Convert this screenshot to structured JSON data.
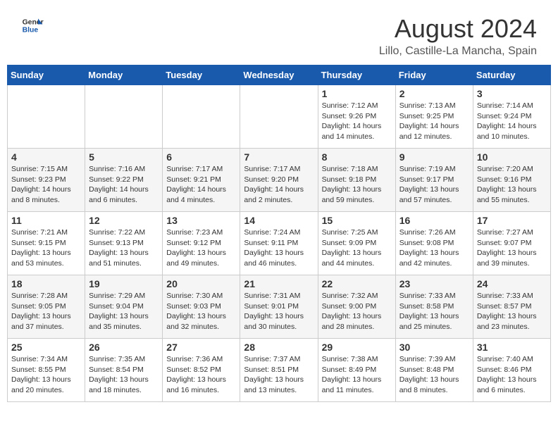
{
  "header": {
    "logo_text_general": "General",
    "logo_text_blue": "Blue",
    "month_title": "August 2024",
    "location": "Lillo, Castille-La Mancha, Spain"
  },
  "days_of_week": [
    "Sunday",
    "Monday",
    "Tuesday",
    "Wednesday",
    "Thursday",
    "Friday",
    "Saturday"
  ],
  "weeks": [
    [
      {
        "day": "",
        "info": ""
      },
      {
        "day": "",
        "info": ""
      },
      {
        "day": "",
        "info": ""
      },
      {
        "day": "",
        "info": ""
      },
      {
        "day": "1",
        "info": "Sunrise: 7:12 AM\nSunset: 9:26 PM\nDaylight: 14 hours\nand 14 minutes."
      },
      {
        "day": "2",
        "info": "Sunrise: 7:13 AM\nSunset: 9:25 PM\nDaylight: 14 hours\nand 12 minutes."
      },
      {
        "day": "3",
        "info": "Sunrise: 7:14 AM\nSunset: 9:24 PM\nDaylight: 14 hours\nand 10 minutes."
      }
    ],
    [
      {
        "day": "4",
        "info": "Sunrise: 7:15 AM\nSunset: 9:23 PM\nDaylight: 14 hours\nand 8 minutes."
      },
      {
        "day": "5",
        "info": "Sunrise: 7:16 AM\nSunset: 9:22 PM\nDaylight: 14 hours\nand 6 minutes."
      },
      {
        "day": "6",
        "info": "Sunrise: 7:17 AM\nSunset: 9:21 PM\nDaylight: 14 hours\nand 4 minutes."
      },
      {
        "day": "7",
        "info": "Sunrise: 7:17 AM\nSunset: 9:20 PM\nDaylight: 14 hours\nand 2 minutes."
      },
      {
        "day": "8",
        "info": "Sunrise: 7:18 AM\nSunset: 9:18 PM\nDaylight: 13 hours\nand 59 minutes."
      },
      {
        "day": "9",
        "info": "Sunrise: 7:19 AM\nSunset: 9:17 PM\nDaylight: 13 hours\nand 57 minutes."
      },
      {
        "day": "10",
        "info": "Sunrise: 7:20 AM\nSunset: 9:16 PM\nDaylight: 13 hours\nand 55 minutes."
      }
    ],
    [
      {
        "day": "11",
        "info": "Sunrise: 7:21 AM\nSunset: 9:15 PM\nDaylight: 13 hours\nand 53 minutes."
      },
      {
        "day": "12",
        "info": "Sunrise: 7:22 AM\nSunset: 9:13 PM\nDaylight: 13 hours\nand 51 minutes."
      },
      {
        "day": "13",
        "info": "Sunrise: 7:23 AM\nSunset: 9:12 PM\nDaylight: 13 hours\nand 49 minutes."
      },
      {
        "day": "14",
        "info": "Sunrise: 7:24 AM\nSunset: 9:11 PM\nDaylight: 13 hours\nand 46 minutes."
      },
      {
        "day": "15",
        "info": "Sunrise: 7:25 AM\nSunset: 9:09 PM\nDaylight: 13 hours\nand 44 minutes."
      },
      {
        "day": "16",
        "info": "Sunrise: 7:26 AM\nSunset: 9:08 PM\nDaylight: 13 hours\nand 42 minutes."
      },
      {
        "day": "17",
        "info": "Sunrise: 7:27 AM\nSunset: 9:07 PM\nDaylight: 13 hours\nand 39 minutes."
      }
    ],
    [
      {
        "day": "18",
        "info": "Sunrise: 7:28 AM\nSunset: 9:05 PM\nDaylight: 13 hours\nand 37 minutes."
      },
      {
        "day": "19",
        "info": "Sunrise: 7:29 AM\nSunset: 9:04 PM\nDaylight: 13 hours\nand 35 minutes."
      },
      {
        "day": "20",
        "info": "Sunrise: 7:30 AM\nSunset: 9:03 PM\nDaylight: 13 hours\nand 32 minutes."
      },
      {
        "day": "21",
        "info": "Sunrise: 7:31 AM\nSunset: 9:01 PM\nDaylight: 13 hours\nand 30 minutes."
      },
      {
        "day": "22",
        "info": "Sunrise: 7:32 AM\nSunset: 9:00 PM\nDaylight: 13 hours\nand 28 minutes."
      },
      {
        "day": "23",
        "info": "Sunrise: 7:33 AM\nSunset: 8:58 PM\nDaylight: 13 hours\nand 25 minutes."
      },
      {
        "day": "24",
        "info": "Sunrise: 7:33 AM\nSunset: 8:57 PM\nDaylight: 13 hours\nand 23 minutes."
      }
    ],
    [
      {
        "day": "25",
        "info": "Sunrise: 7:34 AM\nSunset: 8:55 PM\nDaylight: 13 hours\nand 20 minutes."
      },
      {
        "day": "26",
        "info": "Sunrise: 7:35 AM\nSunset: 8:54 PM\nDaylight: 13 hours\nand 18 minutes."
      },
      {
        "day": "27",
        "info": "Sunrise: 7:36 AM\nSunset: 8:52 PM\nDaylight: 13 hours\nand 16 minutes."
      },
      {
        "day": "28",
        "info": "Sunrise: 7:37 AM\nSunset: 8:51 PM\nDaylight: 13 hours\nand 13 minutes."
      },
      {
        "day": "29",
        "info": "Sunrise: 7:38 AM\nSunset: 8:49 PM\nDaylight: 13 hours\nand 11 minutes."
      },
      {
        "day": "30",
        "info": "Sunrise: 7:39 AM\nSunset: 8:48 PM\nDaylight: 13 hours\nand 8 minutes."
      },
      {
        "day": "31",
        "info": "Sunrise: 7:40 AM\nSunset: 8:46 PM\nDaylight: 13 hours\nand 6 minutes."
      }
    ]
  ]
}
